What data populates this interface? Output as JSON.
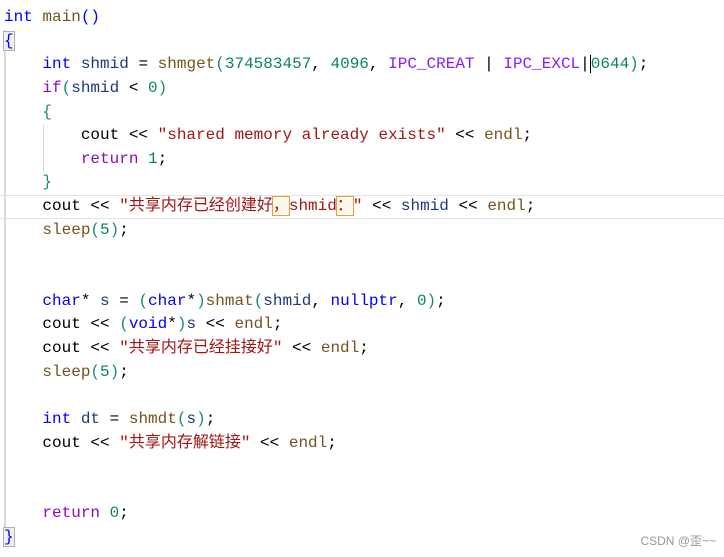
{
  "editor": {
    "lines": [
      [
        [
          "int",
          "kw"
        ],
        [
          " ",
          "p"
        ],
        [
          "main",
          "fn"
        ],
        [
          "()",
          "kw"
        ]
      ],
      [
        [
          "{",
          "bm"
        ]
      ],
      [
        [
          "    ",
          "p"
        ],
        [
          "int",
          "kw"
        ],
        [
          " ",
          "p"
        ],
        [
          "shmid",
          "var"
        ],
        [
          " = ",
          "p"
        ],
        [
          "shmget",
          "fn"
        ],
        [
          "(",
          "br"
        ],
        [
          "374583457",
          "num"
        ],
        [
          ", ",
          "p"
        ],
        [
          "4096",
          "num"
        ],
        [
          ", ",
          "p"
        ],
        [
          "IPC_CREAT",
          "mac"
        ],
        [
          " | ",
          "p"
        ],
        [
          "IPC_EXCL",
          "mac"
        ],
        [
          "|",
          "p"
        ],
        [
          "0644",
          "num caret"
        ],
        [
          ")",
          "br"
        ],
        [
          ";",
          "p"
        ]
      ],
      [
        [
          "    ",
          "p"
        ],
        [
          "if",
          "ctl"
        ],
        [
          "(",
          "br"
        ],
        [
          "shmid",
          "var"
        ],
        [
          " < ",
          "p"
        ],
        [
          "0",
          "num"
        ],
        [
          ")",
          "br"
        ]
      ],
      [
        [
          "    ",
          "p"
        ],
        [
          "{",
          "br"
        ]
      ],
      [
        [
          "        cout << ",
          "p"
        ],
        [
          "\"shared memory already exists\"",
          "str"
        ],
        [
          " << ",
          "p"
        ],
        [
          "endl",
          "fn"
        ],
        [
          ";",
          "p"
        ]
      ],
      [
        [
          "        ",
          "p"
        ],
        [
          "return",
          "ctl"
        ],
        [
          " ",
          "p"
        ],
        [
          "1",
          "num"
        ],
        [
          ";",
          "p"
        ]
      ],
      [
        [
          "    ",
          "p"
        ],
        [
          "}",
          "br"
        ]
      ],
      [
        [
          "    cout << ",
          "p"
        ],
        [
          "\"共享内存已经创建好",
          "str"
        ],
        [
          "，",
          "hl"
        ],
        [
          "shmid",
          "str"
        ],
        [
          "：",
          "hl"
        ],
        [
          "\"",
          "str"
        ],
        [
          " << ",
          "p"
        ],
        [
          "shmid",
          "var"
        ],
        [
          " << ",
          "p"
        ],
        [
          "endl",
          "fn"
        ],
        [
          ";",
          "p"
        ]
      ],
      [
        [
          "    ",
          "p"
        ],
        [
          "sleep",
          "fn"
        ],
        [
          "(",
          "br"
        ],
        [
          "5",
          "num"
        ],
        [
          ")",
          "br"
        ],
        [
          ";",
          "p"
        ]
      ],
      [],
      [],
      [
        [
          "    ",
          "p"
        ],
        [
          "char",
          "kw"
        ],
        [
          "* ",
          "p"
        ],
        [
          "s",
          "var"
        ],
        [
          " = ",
          "p"
        ],
        [
          "(",
          "br"
        ],
        [
          "char",
          "kw"
        ],
        [
          "*",
          "p"
        ],
        [
          ")",
          "br"
        ],
        [
          "shmat",
          "fn"
        ],
        [
          "(",
          "br"
        ],
        [
          "shmid",
          "var"
        ],
        [
          ", ",
          "p"
        ],
        [
          "nullptr",
          "kw"
        ],
        [
          ", ",
          "p"
        ],
        [
          "0",
          "num"
        ],
        [
          ")",
          "br"
        ],
        [
          ";",
          "p"
        ]
      ],
      [
        [
          "    cout << ",
          "p"
        ],
        [
          "(",
          "br"
        ],
        [
          "void",
          "kw"
        ],
        [
          "*",
          "p"
        ],
        [
          ")",
          "br"
        ],
        [
          "s",
          "var"
        ],
        [
          " << ",
          "p"
        ],
        [
          "endl",
          "fn"
        ],
        [
          ";",
          "p"
        ]
      ],
      [
        [
          "    cout << ",
          "p"
        ],
        [
          "\"共享内存已经挂接好\"",
          "str"
        ],
        [
          " << ",
          "p"
        ],
        [
          "endl",
          "fn"
        ],
        [
          ";",
          "p"
        ]
      ],
      [
        [
          "    ",
          "p"
        ],
        [
          "sleep",
          "fn"
        ],
        [
          "(",
          "br"
        ],
        [
          "5",
          "num"
        ],
        [
          ")",
          "br"
        ],
        [
          ";",
          "p"
        ]
      ],
      [],
      [
        [
          "    ",
          "p"
        ],
        [
          "int",
          "kw"
        ],
        [
          " ",
          "p"
        ],
        [
          "dt",
          "var"
        ],
        [
          " = ",
          "p"
        ],
        [
          "shmdt",
          "fn"
        ],
        [
          "(",
          "br"
        ],
        [
          "s",
          "var"
        ],
        [
          ")",
          "br"
        ],
        [
          ";",
          "p"
        ]
      ],
      [
        [
          "    cout << ",
          "p"
        ],
        [
          "\"共享内存解链接\"",
          "str"
        ],
        [
          " << ",
          "p"
        ],
        [
          "endl",
          "fn"
        ],
        [
          ";",
          "p"
        ]
      ],
      [],
      [],
      [
        [
          "    ",
          "p"
        ],
        [
          "return",
          "ctl"
        ],
        [
          " ",
          "p"
        ],
        [
          "0",
          "num"
        ],
        [
          ";",
          "p"
        ]
      ],
      [
        [
          "}",
          "bm"
        ]
      ]
    ],
    "current_line": 8
  },
  "watermark": "CSDN @歪~~"
}
